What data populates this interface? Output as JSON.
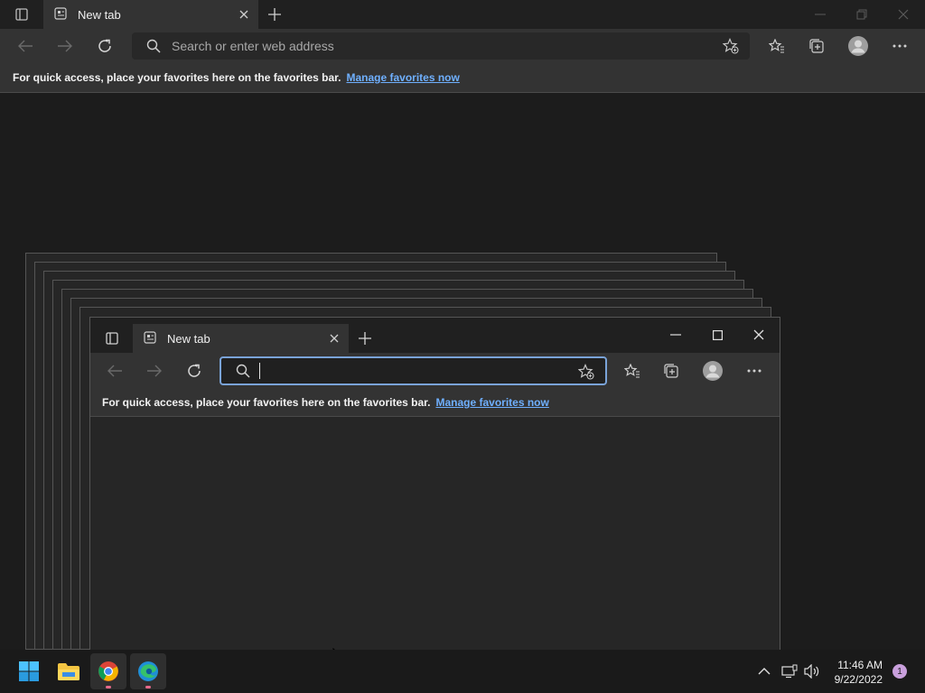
{
  "back_window": {
    "tab": {
      "title": "New tab"
    },
    "address": {
      "placeholder": "Search or enter web address"
    },
    "favorites_bar": {
      "hint": "For quick access, place your favorites here on the favorites bar.",
      "link": "Manage favorites now"
    }
  },
  "front_window": {
    "tab": {
      "title": "New tab"
    },
    "address": {
      "value": ""
    },
    "favorites_bar": {
      "hint": "For quick access, place your favorites here on the favorites bar.",
      "link": "Manage favorites now"
    }
  },
  "taskbar": {
    "apps": [
      "start-icon",
      "file-explorer-icon",
      "chrome-icon",
      "edge-icon"
    ],
    "clock": {
      "time": "11:46 AM",
      "date": "9/22/2022"
    },
    "notification_count": "1"
  },
  "colors": {
    "accent_link": "#6fb0ff",
    "focus_border": "#7aa3d8",
    "badge": "#c9a0dc"
  }
}
